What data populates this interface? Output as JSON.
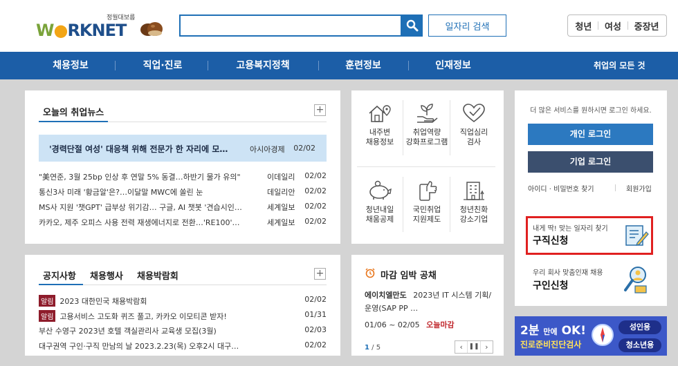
{
  "header": {
    "logo_sub": "정월대보름",
    "logo_w": "W",
    "logo_rest": "RKNET",
    "search_placeholder": "",
    "job_search_label": "일자리 검색",
    "audience": [
      "청년",
      "여성",
      "중장년"
    ]
  },
  "nav": {
    "items": [
      "채용정보",
      "직업·진로",
      "고용복지정책",
      "훈련정보",
      "인재정보"
    ],
    "right": "취업의 모든 것"
  },
  "news": {
    "tab": "오늘의 취업뉴스",
    "headline": {
      "title": "'경력단절 여성' 대응책 위해 전문가 한 자리에 모…",
      "source": "아시아경제",
      "date": "02/02"
    },
    "rows": [
      {
        "title": "\"美연준, 3월 25bp 인상 후 연말 5% 동결…하반기 물가 유의\"",
        "source": "이데일리",
        "date": "02/02"
      },
      {
        "title": "통신3사 미래 '황금알'은?…이달말 MWC에 쏠린 눈",
        "source": "데일리안",
        "date": "02/02"
      },
      {
        "title": "MS사 지원 '챗GPT' 급부상 위기감… 구글, AI 챗봇 '견습시인…",
        "source": "세계일보",
        "date": "02/02"
      },
      {
        "title": "카카오, 제주 오피스 사용 전력 재생에너지로 전환…'RE100'…",
        "source": "세계일보",
        "date": "02/02"
      }
    ]
  },
  "services": [
    {
      "line1": "내주변",
      "line2": "채용정보",
      "icon": "house-location-icon"
    },
    {
      "line1": "취업역량",
      "line2": "강화프로그램",
      "icon": "plant-hand-icon"
    },
    {
      "line1": "직업심리",
      "line2": "검사",
      "icon": "heart-check-icon"
    },
    {
      "line1": "청년내일",
      "line2": "채움공제",
      "icon": "piggy-bank-icon"
    },
    {
      "line1": "국민취업",
      "line2": "지원제도",
      "icon": "thumbs-up-phone-icon"
    },
    {
      "line1": "청년친화",
      "line2": "강소기업",
      "icon": "building-icon"
    }
  ],
  "notice": {
    "tabs": [
      "공지사항",
      "채용행사",
      "채용박람회"
    ],
    "badge": "알림",
    "rows": [
      {
        "badge": true,
        "title": "2023 대한민국 채용박람회",
        "date": "02/02"
      },
      {
        "badge": true,
        "title": "고용서비스 고도화 퀴즈 풀고, 카카오 이모티콘 받자!",
        "date": "01/31"
      },
      {
        "badge": false,
        "title": "부산 수영구 2023년 호텔 객실관리사 교육생 모집(3월)",
        "date": "02/03"
      },
      {
        "badge": false,
        "title": "대구권역 구인·구직 만남의 날 2023.2.23(목) 오후2시 대구…",
        "date": "02/02"
      }
    ]
  },
  "deadline": {
    "title": "마감 임박 공채",
    "company": "에이치엘만도",
    "job": "2023년 IT 시스템 기획/운영(SAP PP …",
    "period": "01/06 ~ 02/05",
    "status": "오늘마감",
    "page_current": "1",
    "page_total": "/ 5"
  },
  "login": {
    "message": "더 많은 서비스를 원하시면 로그인 하세요.",
    "personal": "개인 로그인",
    "company": "기업 로그인",
    "find": "아이디 · 비밀번호 찾기",
    "join": "회원가입"
  },
  "cards": {
    "job_apply_sub": "내게 딱! 맞는 일자리 찾기",
    "job_apply": "구직신청",
    "hire_sub": "우리 회사 맞춤인재 채용",
    "hire": "구인신청"
  },
  "banner": {
    "big": "2분",
    "mid": "만에",
    "ok": "OK!",
    "sub": "진로준비진단검사",
    "adult": "성인용",
    "youth": "청소년용"
  },
  "colors": {
    "primary": "#1e6fb6",
    "nav": "#1c5ea7",
    "headline_bg": "#cde3f5",
    "badge": "#8e1c2b",
    "highlight_border": "#e02020",
    "deadline_orange": "#e8751a",
    "dark_login": "#3b4f6e"
  }
}
